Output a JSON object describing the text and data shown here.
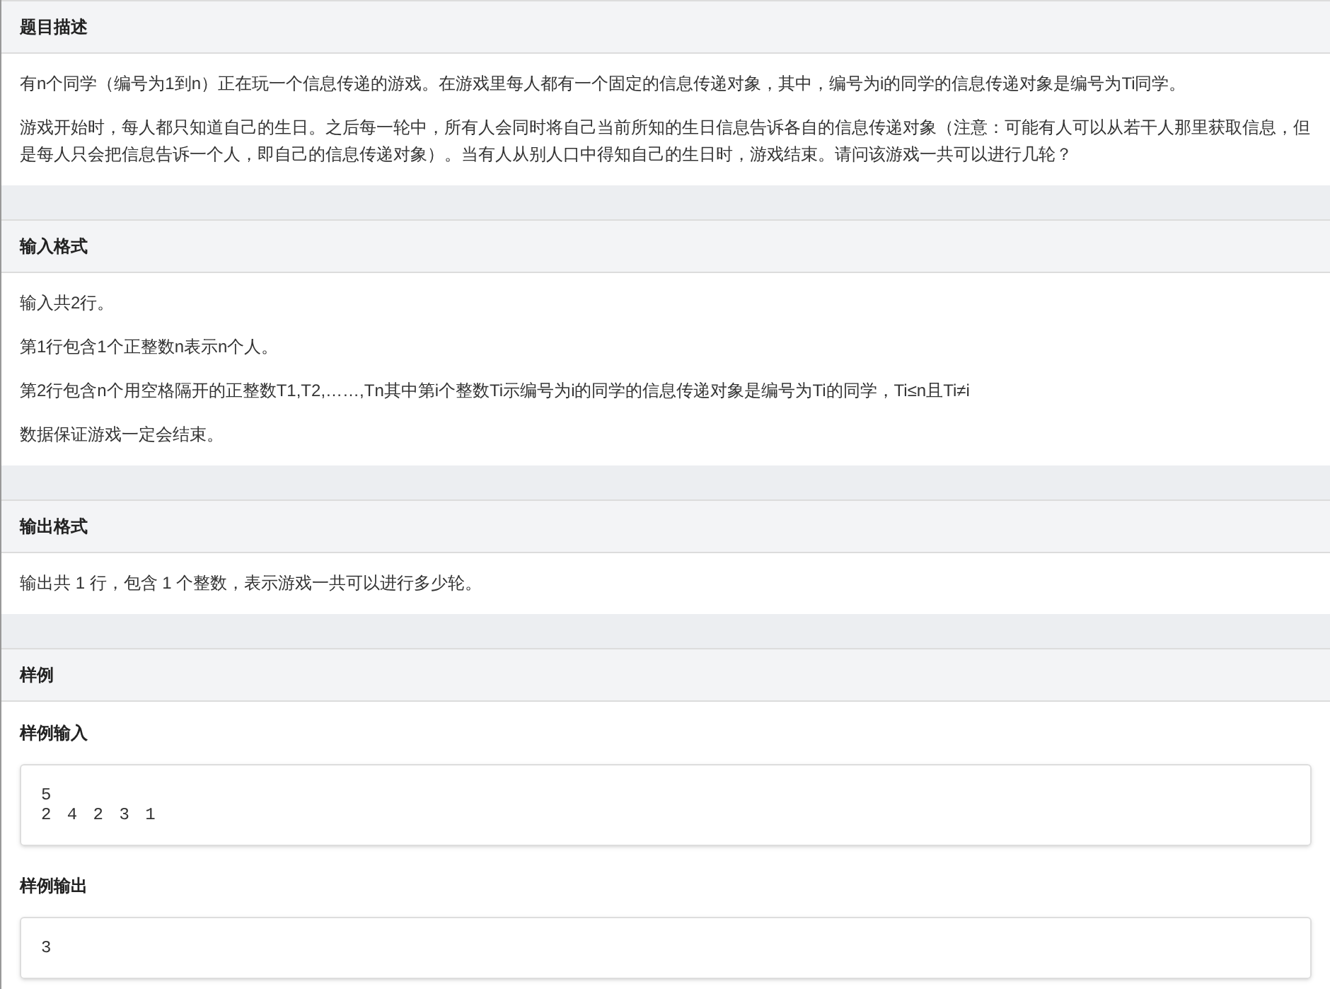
{
  "sections": [
    {
      "title": "题目描述",
      "paragraphs": [
        "有n个同学（编号为1到n）正在玩一个信息传递的游戏。在游戏里每人都有一个固定的信息传递对象，其中，编号为i的同学的信息传递对象是编号为Ti同学。",
        "游戏开始时，每人都只知道自己的生日。之后每一轮中，所有人会同时将自己当前所知的生日信息告诉各自的信息传递对象（注意：可能有人可以从若干人那里获取信息，但是每人只会把信息告诉一个人，即自己的信息传递对象）。当有人从别人口中得知自己的生日时，游戏结束。请问该游戏一共可以进行几轮？"
      ]
    },
    {
      "title": "输入格式",
      "paragraphs": [
        "输入共2行。",
        "第1行包含1个正整数n表示n个人。",
        "第2行包含n个用空格隔开的正整数T1,T2,……,Tn其中第i个整数Ti示编号为i的同学的信息传递对象是编号为Ti的同学，Ti≤n且Ti≠i",
        "数据保证游戏一定会结束。"
      ]
    },
    {
      "title": "输出格式",
      "paragraphs": [
        "输出共 1 行，包含 1 个整数，表示游戏一共可以进行多少轮。"
      ]
    },
    {
      "title": "样例",
      "samples": [
        {
          "label": "样例输入",
          "code": "5\n2 4 2 3 1"
        },
        {
          "label": "样例输出",
          "code": "3"
        }
      ]
    }
  ]
}
